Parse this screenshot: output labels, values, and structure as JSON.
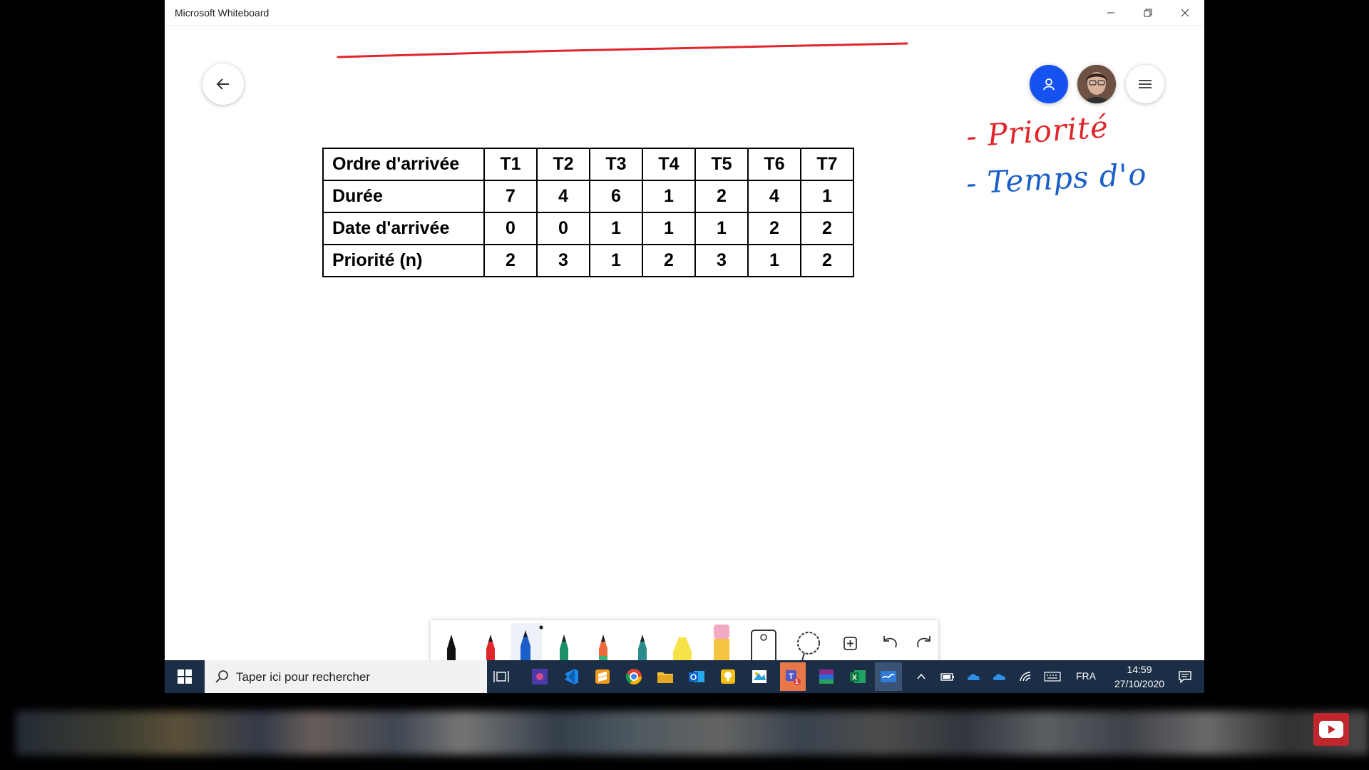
{
  "window": {
    "title": "Microsoft Whiteboard"
  },
  "table": {
    "rows": [
      [
        "Ordre d'arrivée",
        "T1",
        "T2",
        "T3",
        "T4",
        "T5",
        "T6",
        "T7"
      ],
      [
        "Durée",
        "7",
        "4",
        "6",
        "1",
        "2",
        "4",
        "1"
      ],
      [
        "Date d'arrivée",
        "0",
        "0",
        "1",
        "1",
        "1",
        "2",
        "2"
      ],
      [
        "Priorité (n)",
        "2",
        "3",
        "1",
        "2",
        "3",
        "1",
        "2"
      ]
    ]
  },
  "handwriting": {
    "line1": "- Priorité",
    "line2": "- Temps d'o"
  },
  "colors": {
    "ink_red": "#e0252b",
    "ink_blue": "#1a5fc8",
    "accent_blue": "#1552f0",
    "taskbar": "#1c2e45"
  },
  "toolbar": {
    "tools": [
      "black-pen",
      "red-pen",
      "blue-pen",
      "green-pen",
      "rainbow-pen",
      "galaxy-pen",
      "highlighter",
      "eraser",
      "ruler",
      "lasso",
      "add",
      "undo",
      "redo"
    ]
  },
  "taskbar": {
    "search_placeholder": "Taper ici pour rechercher",
    "language": "FRA",
    "time": "14:59",
    "date": "27/10/2020",
    "teams_badge": "1"
  }
}
